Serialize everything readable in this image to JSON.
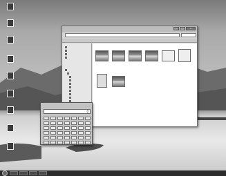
{
  "desktop": {
    "icons": [
      {
        "icon": "computer-icon",
        "label": ""
      },
      {
        "icon": "folder-icon",
        "label": ""
      },
      {
        "icon": "network-icon",
        "label": ""
      },
      {
        "icon": "recycle-bin-icon",
        "label": ""
      },
      {
        "icon": "folder-icon",
        "label": ""
      },
      {
        "icon": "shortcut-icon",
        "label": ""
      },
      {
        "icon": "app-icon",
        "label": ""
      },
      {
        "icon": "app-icon",
        "label": ""
      },
      {
        "icon": "app-icon",
        "label": ""
      }
    ]
  },
  "explorer": {
    "address": "",
    "search_placeholder": "",
    "menu": [
      "",
      "",
      "",
      "",
      "",
      ""
    ],
    "nav_items": [
      "",
      "",
      "",
      "",
      "",
      "",
      "",
      "",
      "",
      "",
      "",
      "",
      "",
      "",
      "",
      "",
      ""
    ],
    "files": [
      {
        "name": ""
      },
      {
        "name": ""
      },
      {
        "name": ""
      },
      {
        "name": ""
      },
      {
        "name": ""
      },
      {
        "name": ""
      },
      {
        "name": ""
      },
      {
        "name": ""
      }
    ]
  },
  "calculator": {
    "title": "",
    "display": "0"
  },
  "taskbar": {
    "clock": ""
  },
  "colors": {
    "taskbar": "#2c2c2c",
    "window_frame": "#d6d6d6"
  }
}
